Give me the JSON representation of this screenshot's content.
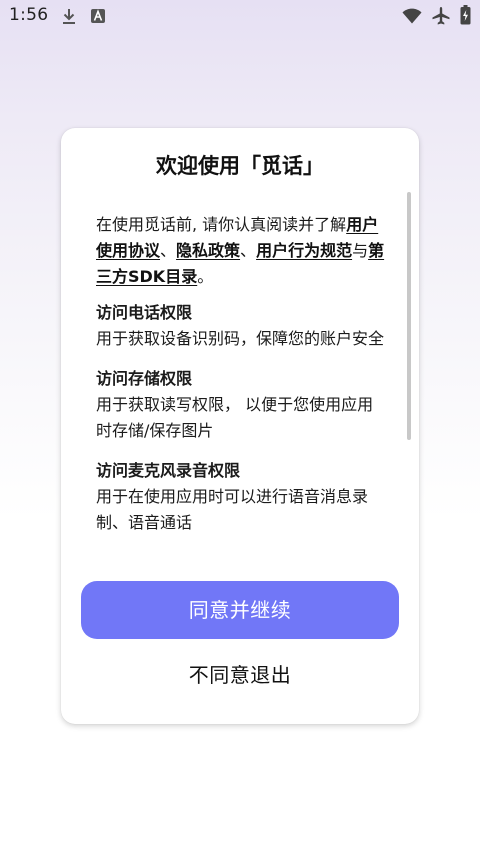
{
  "status_bar": {
    "time": "1:56",
    "left_icons": [
      "download-icon",
      "font-a-icon"
    ],
    "right_icons": [
      "wifi-icon",
      "airplane-icon",
      "battery-icon"
    ]
  },
  "dialog": {
    "title": "欢迎使用「觅话」",
    "intro": {
      "prefix": "在使用觅话前, 请你认真阅读并了解",
      "link_user_agreement": "用户使用协议",
      "sep1": "、",
      "link_privacy": "隐私政策",
      "sep2": "、",
      "link_behavior": "用户行为规范",
      "and": "与",
      "link_sdk": "第三方SDK目录",
      "end": "。"
    },
    "permissions": [
      {
        "title": "访问电话权限",
        "desc": "用于获取设备识别码，保障您的账户安全"
      },
      {
        "title": "访问存储权限",
        "desc": "用于获取读写权限， 以便于您使用应用时存储/保存图片"
      },
      {
        "title": "访问麦克风录音权限",
        "desc": "用于在使用应用时可以进行语音消息录制、语音通话"
      }
    ],
    "agree_label": "同意并继续",
    "decline_label": "不同意退出"
  },
  "colors": {
    "accent": "#7177f7",
    "background_top": "#e6e0f3",
    "dialog_bg": "#ffffff"
  }
}
